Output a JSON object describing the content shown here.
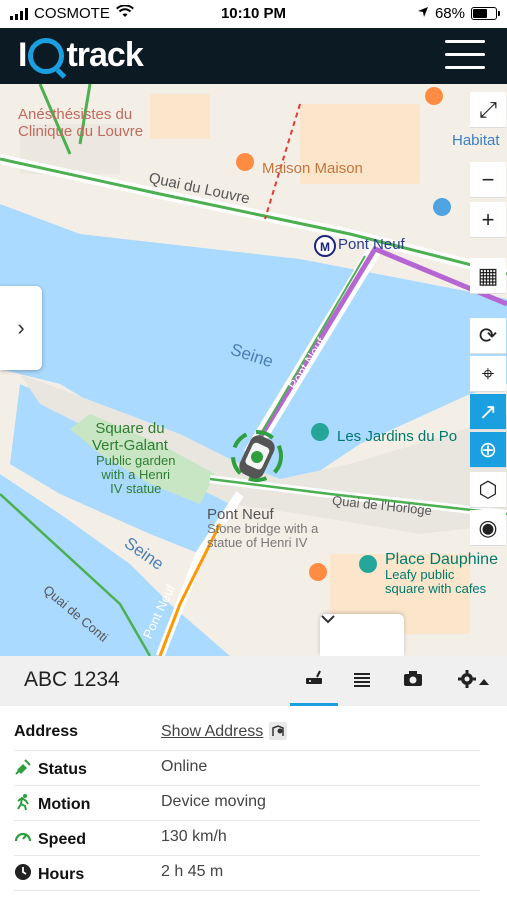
{
  "status_bar": {
    "carrier": "COSMOTE",
    "time": "10:10 PM",
    "battery": "68%",
    "battery_level": 0.68
  },
  "app": {
    "logo_left": "I",
    "logo_right": "track"
  },
  "map": {
    "labels": {
      "clinic": "Anésthésistes du\nClinique du Louvre",
      "maison": "Maison Maison",
      "habitat": "Habitat",
      "quai_louvre": "Quai du Louvre",
      "pont_neuf_metro": "Pont Neuf",
      "seine_upper": "Seine",
      "seine_lower": "Seine",
      "pont_neuf_road": "Pont Neuf",
      "square_title": "Square du\nVert-Galant",
      "square_desc": "Public garden\nwith a Henri\nIV statue",
      "jardins": "Les Jardins du Po",
      "pont_neuf_poi": "Pont Neuf",
      "pont_neuf_desc": "Stone bridge with a\nstatue of Henri IV",
      "quai_horloge": "Quai de l'Horloge",
      "place_dauphine": "Place Dauphine",
      "place_desc": "Leafy public\nsquare with cafes",
      "quai_conti": "Quai de Conti",
      "pont_neuf_lower": "Pont Neuf"
    },
    "colors": {
      "water": "#aadaff",
      "land": "#f4efe6",
      "route": "#b666d2",
      "traffic": "#4caf50"
    }
  },
  "controls": [
    {
      "name": "fullscreen-icon",
      "glyph": "⤢"
    },
    {
      "name": "zoom-out-icon",
      "glyph": "−"
    },
    {
      "name": "zoom-in-icon",
      "glyph": "+"
    },
    {
      "name": "map-layers-icon",
      "glyph": "▦"
    },
    {
      "name": "route-icon",
      "glyph": "⟳"
    },
    {
      "name": "location-pin-icon",
      "glyph": "⌖"
    },
    {
      "name": "trend-icon",
      "glyph": "↗"
    },
    {
      "name": "crosshair-icon",
      "glyph": "⊕"
    },
    {
      "name": "tag-icon",
      "glyph": "⬡"
    },
    {
      "name": "eye-icon",
      "glyph": "◉"
    }
  ],
  "panel": {
    "plate": "ABC 1234",
    "tabs": [
      "device-tab",
      "list-tab",
      "camera-tab",
      "settings-tab"
    ],
    "rows": {
      "address_label": "Address",
      "address_value": "Show Address",
      "status_label": "Status",
      "status_value": "Online",
      "motion_label": "Motion",
      "motion_value": "Device moving",
      "speed_label": "Speed",
      "speed_value": "130 km/h",
      "hours_label": "Hours",
      "hours_value": "2 h 45 m"
    }
  }
}
